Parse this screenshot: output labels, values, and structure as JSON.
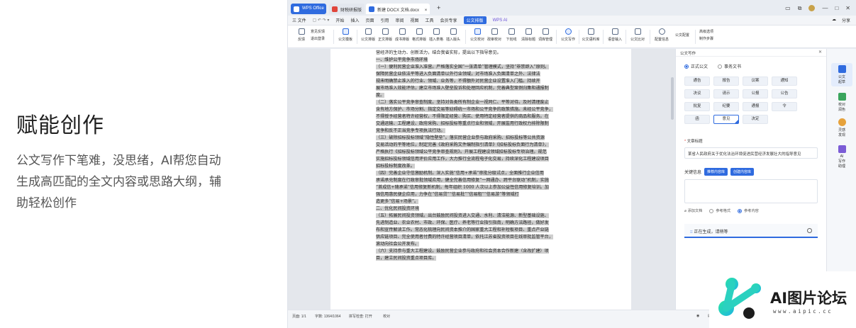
{
  "promo": {
    "title": "赋能创作",
    "description": "公文写作下笔难，没思绪，AI帮您自动生成高匹配的全文内容或思路大纲，辅助轻松创作"
  },
  "app": {
    "tabs": [
      {
        "label": "WPS Office"
      },
      {
        "label": "财税研报版"
      },
      {
        "label": "新建 DOCX 文档.docx"
      }
    ],
    "menu": [
      "三 文件",
      "开始",
      "插入",
      "页面",
      "引用",
      "审阅",
      "视图",
      "工具",
      "会员专享",
      "公文排版",
      "WPS AI"
    ],
    "menu_active": "公文排版",
    "menu_right": [
      "分享"
    ],
    "ribbon": {
      "groups": [
        "意见反馈",
        "退出登录",
        "公文模板",
        "公文排版",
        "正文排版",
        "成书排版",
        "格式排版",
        "插入表格",
        "插入版头",
        "公文校对",
        "政审校对",
        "下划线",
        "清除标题",
        "词库管理",
        "公文写作",
        "公文语料库",
        "语音输入",
        "公文比对",
        "配置信息"
      ],
      "side_items": [
        "公文配置",
        "高级选项",
        "制作步骤"
      ],
      "left_items": [
        "意见反馈",
        "退出登录"
      ],
      "bottom_labels": [
        "反馈",
        "退出"
      ]
    },
    "document": {
      "lines": [
        "营经济的生动力、创新活力，结合我省实际，提出以下指导意见。",
        "一、维护公平竞争市场环境",
        "（一）便利民营企业准入准营。严格落实全国“一张清单”管理模式，坚持“非禁即入”原则。",
        "保障民营企业依法平等进入负面清单以外行业领域，对市场准入负面清单之外、法律法",
        "规未明确禁止准入的行业、领域、业务等，不得额外对民营企业设置准入门槛。持续开",
        "展市场准入效能评估，建立市场准入壁垒投诉和处理回应机制，完善典型案例归集和通报制",
        "度。",
        "（二）落实公平竞争审查制度。坚持对各类所有制企业一视同仁、平等对待。及时清理废止",
        "含有地方保护、市场分割、指定交易等妨碍统一市场和公平竞争的政策措施。未经公平竞争，",
        "不得授予经营者特许经营权，不得限定经营、购买、使用特定经营者提供的商品和服务。在",
        "交通运输、工程建设、政府采购、招标投标等重点行业和领域，开展滥用行政权力排除限制",
        "竞争和反不正当竞争专项执法行动。",
        "（三）破除招标投标领域“隐性壁垒”。落实民营企业参与政府采购、招标投标等公共资源",
        "交易活动的平等地位，制定完善《政府采购文件编制指引清单》《招标投标负面行为清单》，",
        "严格执行《招标投标领域公平竞争审查规则》。开展工程建设领域招标投标专项治理。规范",
        "实施招标投标领域信用评价应用工作，大力推行全流程电子化交易，持续深化工程建设项目",
        "招标投标制度改革。",
        "（四）完善企业守信激励机制。深入实施“信用+承诺”审批分级试点，全面推行企业信用",
        "承诺承兑制度在行政审批领域应用，健全完善信用修复“一网通办、跨平台联动”机制，实施",
        "“首成信+随承诺”信用修复新机制，每年组织 1000 人次以上参加公益性信用修复培训。加",
        "强信用惠民便企应用，力争在“信易贷”“信易批”“信易租”“信易游”等领域打",
        "造更多“信易+场景”。",
        "二、优化民间投资环境",
        "（五）拓展民间投资领域。出台鼓励民间投资进入交通、水利、清洁能源、新型基础设施、",
        "先进制造业、农业农村、市政、环保、医疗、养老等行业指引指南，明确方法路径，做好发",
        "布和宣传解读工作。常态化梳理向民间资本推介的国家重大工程和补短板项目、重点产业链",
        "供应链项目、完全使用者付费的特许经营项目清单，依托江苏省投资项目在线审批监管平台，",
        "滚动向社会公开发布。",
        "（六）支持参与重大工程建设。鼓励民营企业参与政府和社会资本合作新建（含改扩建）项",
        "目，建立民间投资重点项目库。"
      ]
    },
    "panel": {
      "header": "公文写作",
      "radio_options": [
        {
          "label": "正式公文",
          "selected": true
        },
        {
          "label": "事务文书",
          "selected": false
        }
      ],
      "types": [
        "通告",
        "报告",
        "议案",
        "通知",
        "决议",
        "请示",
        "公报",
        "公告",
        "批复",
        "纪要",
        "通报",
        "令",
        "函",
        "意见",
        "决定"
      ],
      "selected_type": "意见",
      "title_label": "文章标题",
      "title_value": "某省人民政府关于优化法治环境促进民营经济发展壮大的指导意见",
      "keywords_label": "关键信息",
      "keywords_chips": [
        "推荐内容库",
        "创建内容库"
      ],
      "options": [
        "添加文档",
        "参考格式",
        "参考内容"
      ],
      "generating": "正在生成，请稍等"
    },
    "vtool": [
      {
        "label": "公文\n起草"
      },
      {
        "label": "校对\n润色"
      },
      {
        "label": "灵感\n发现"
      },
      {
        "label": "AI\n写作\n助理"
      }
    ],
    "status": {
      "page": "页面: 1/1",
      "words": "字数: 1364/1064",
      "spell": "拼写检查: 打开",
      "proof": "校对"
    }
  },
  "watermark": {
    "text": "AI图片论坛",
    "url": "www.aipic.cc"
  }
}
